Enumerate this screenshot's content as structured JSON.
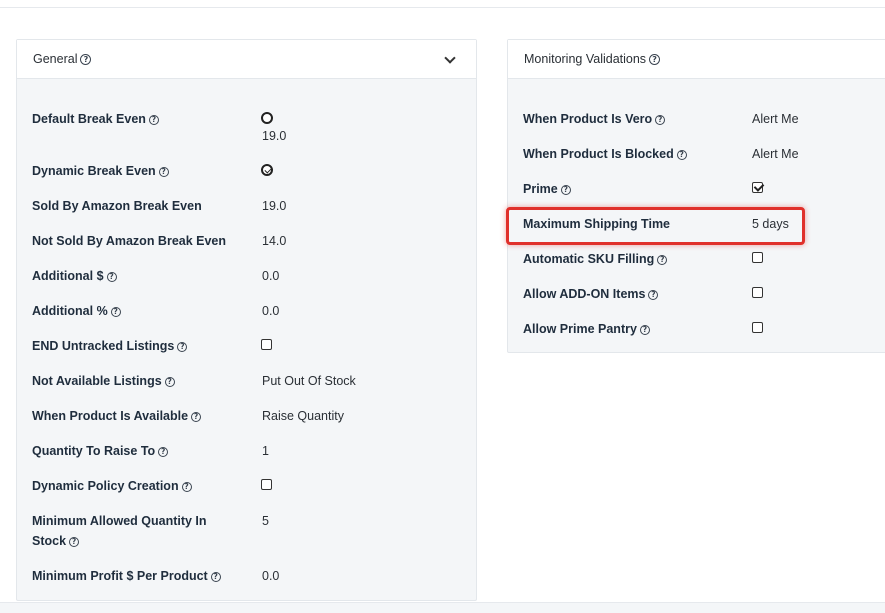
{
  "general": {
    "title": "General",
    "rows": {
      "default_break_even": {
        "label": "Default Break Even",
        "value": "19.0"
      },
      "dynamic_break_even": {
        "label": "Dynamic Break Even"
      },
      "sold_by_amazon": {
        "label": "Sold By Amazon Break Even",
        "value": "19.0"
      },
      "not_sold_by_amazon": {
        "label": "Not Sold By Amazon Break Even",
        "value": "14.0"
      },
      "additional_dollar": {
        "label": "Additional $",
        "value": "0.0"
      },
      "additional_percent": {
        "label": "Additional %",
        "value": "0.0"
      },
      "end_untracked": {
        "label": "END Untracked Listings",
        "checked": false
      },
      "not_available": {
        "label": "Not Available Listings",
        "value": "Put Out Of Stock"
      },
      "when_available": {
        "label": "When Product Is Available",
        "value": "Raise Quantity"
      },
      "quantity_raise": {
        "label": "Quantity To Raise To",
        "value": "1"
      },
      "dynamic_policy": {
        "label": "Dynamic Policy Creation",
        "checked": false
      },
      "min_quantity": {
        "label_line1": "Minimum Allowed Quantity In",
        "label_line2": "Stock",
        "value": "5"
      },
      "min_profit": {
        "label": "Minimum Profit $ Per Product",
        "value": "0.0"
      }
    }
  },
  "monitoring": {
    "title": "Monitoring Validations",
    "rows": {
      "vero": {
        "label": "When Product Is Vero",
        "value": "Alert Me"
      },
      "blocked": {
        "label": "When Product Is Blocked",
        "value": "Alert Me"
      },
      "prime": {
        "label": "Prime",
        "checked": true
      },
      "max_shipping": {
        "label": "Maximum Shipping Time",
        "value": "5 days"
      },
      "auto_sku": {
        "label": "Automatic SKU Filling",
        "checked": false
      },
      "addon": {
        "label": "Allow ADD-ON Items",
        "checked": false
      },
      "pantry": {
        "label": "Allow Prime Pantry",
        "checked": false
      }
    }
  },
  "icons": {
    "help": "?"
  },
  "colors": {
    "highlight": "#e0302b",
    "panel_bg": "#f4f6f8"
  }
}
